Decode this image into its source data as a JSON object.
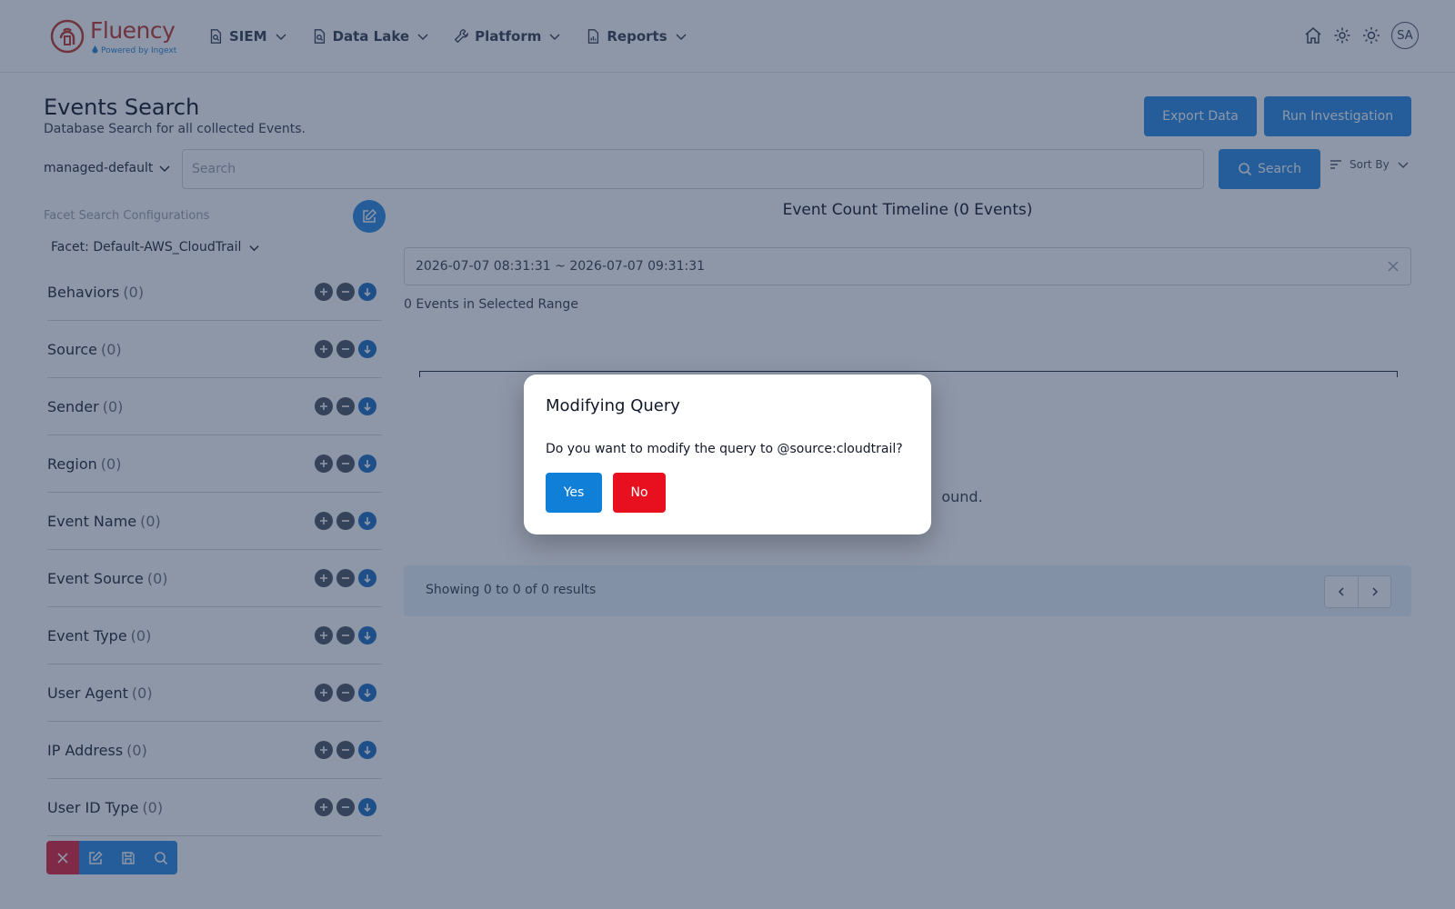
{
  "header": {
    "logo": {
      "name": "Fluency",
      "tagline": "Powered by Ingext"
    },
    "nav": [
      {
        "label": "SIEM",
        "icon": "document-search-icon"
      },
      {
        "label": "Data Lake",
        "icon": "document-search-icon"
      },
      {
        "label": "Platform",
        "icon": "wrench-icon"
      },
      {
        "label": "Reports",
        "icon": "chart-document-icon"
      }
    ],
    "avatar_initials": "SA"
  },
  "page": {
    "title": "Events Search",
    "subtitle": "Database Search for all collected Events.",
    "export_label": "Export Data",
    "run_label": "Run Investigation"
  },
  "search": {
    "dataset": "managed-default",
    "placeholder": "Search",
    "value": "",
    "button_label": "Search",
    "sort_label": "Sort By"
  },
  "facets": {
    "config_label": "Facet Search Configurations",
    "selected": "Facet: Default-AWS_CloudTrail",
    "items": [
      {
        "name": "Behaviors",
        "count": "(0)"
      },
      {
        "name": "Source",
        "count": "(0)"
      },
      {
        "name": "Sender",
        "count": "(0)"
      },
      {
        "name": "Region",
        "count": "(0)"
      },
      {
        "name": "Event Name",
        "count": "(0)"
      },
      {
        "name": "Event Source",
        "count": "(0)"
      },
      {
        "name": "Event Type",
        "count": "(0)"
      },
      {
        "name": "User Agent",
        "count": "(0)"
      },
      {
        "name": "IP Address",
        "count": "(0)"
      },
      {
        "name": "User ID Type",
        "count": "(0)"
      }
    ]
  },
  "timeline": {
    "title": "Event Count Timeline (0 Events)",
    "range": "2026-07-07 08:31:31 ~ 2026-07-07 09:31:31",
    "events_in_range": "0 Events in Selected Range",
    "no_results_tail": "ound."
  },
  "results": {
    "summary": "Showing 0 to 0 of 0 results"
  },
  "modal": {
    "title": "Modifying Query",
    "message": "Do you want to modify the query to @source:cloudtrail?",
    "yes_label": "Yes",
    "no_label": "No"
  },
  "colors": {
    "primary": "#2b8be0",
    "danger": "#e8101f",
    "brand": "#c0392b",
    "overlay": "#1e3052"
  }
}
